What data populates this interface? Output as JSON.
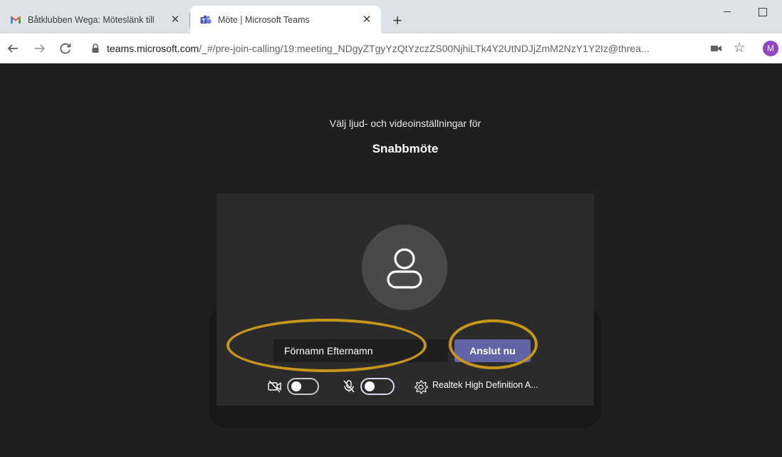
{
  "browser": {
    "tabs": [
      {
        "title": "Båtklubben Wega: Möteslänk till",
        "icon": "gmail-icon",
        "close": "✕",
        "active": false
      },
      {
        "title": "Möte | Microsoft Teams",
        "icon": "teams-icon",
        "close": "✕",
        "active": true
      }
    ],
    "new_tab": "+",
    "address": {
      "host": "teams.microsoft.com",
      "path": "/_#/pre-join-calling/19:meeting_NDgyZTgyYzQtYzczZS00NjhiLTk4Y2UtNDJjZmM2NzY1Y2Iz@threa..."
    },
    "profile_initial": "M",
    "colors": {
      "tabstrip": "#dee1e6",
      "profile": "#8e44c4"
    }
  },
  "prejoin": {
    "subtitle": "Välj ljud- och videoinställningar för",
    "meeting_title": "Snabbmöte",
    "name_placeholder": "Förnamn Efternamn",
    "join_label": "Anslut nu",
    "camera_toggle": {
      "icon": "camera-off-icon",
      "on": false
    },
    "mic_toggle": {
      "icon": "mic-off-icon",
      "on": false
    },
    "device": {
      "icon": "gear-icon",
      "label": "Realtek High Definition A..."
    },
    "colors": {
      "background": "#1f1f1f",
      "card": "#2b2b2b",
      "accent": "#6264a7",
      "highlight": "#c6961a"
    }
  }
}
